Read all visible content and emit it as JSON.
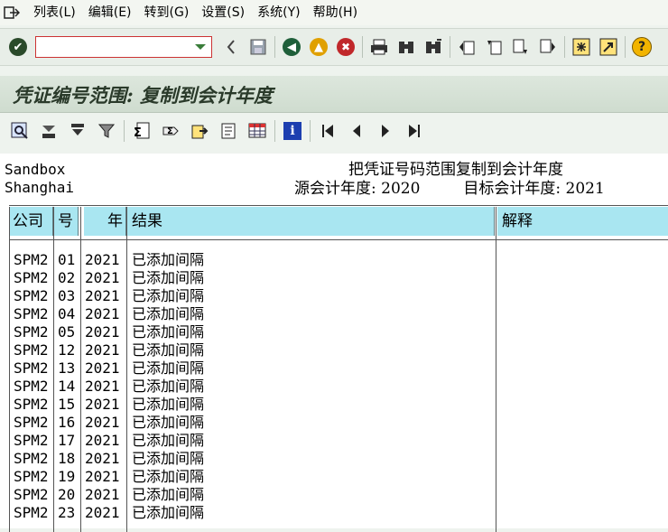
{
  "menubar": {
    "items": [
      {
        "label": "列表(L)"
      },
      {
        "label": "编辑(E)"
      },
      {
        "label": "转到(G)"
      },
      {
        "label": "设置(S)"
      },
      {
        "label": "系统(Y)"
      },
      {
        "label": "帮助(H)"
      }
    ]
  },
  "toolbar": {
    "command_value": "",
    "command_placeholder": ""
  },
  "titlebar": {
    "title": "凭证编号范围: 复制到会计年度"
  },
  "report": {
    "client_line1": "Sandbox",
    "client_line2": "Shanghai",
    "heading": "把凭证号码范围复制到会计年度",
    "source_year_label": "源会计年度: 2020",
    "target_year_label": "目标会计年度: 2021",
    "columns": {
      "company": "公司",
      "number": "号",
      "year": "年",
      "result": "结果",
      "explanation": "解释"
    },
    "rows": [
      {
        "company": "SPM2",
        "number": "01",
        "year": "2021",
        "result": "已添加间隔",
        "explanation": ""
      },
      {
        "company": "SPM2",
        "number": "02",
        "year": "2021",
        "result": "已添加间隔",
        "explanation": ""
      },
      {
        "company": "SPM2",
        "number": "03",
        "year": "2021",
        "result": "已添加间隔",
        "explanation": ""
      },
      {
        "company": "SPM2",
        "number": "04",
        "year": "2021",
        "result": "已添加间隔",
        "explanation": ""
      },
      {
        "company": "SPM2",
        "number": "05",
        "year": "2021",
        "result": "已添加间隔",
        "explanation": ""
      },
      {
        "company": "SPM2",
        "number": "12",
        "year": "2021",
        "result": "已添加间隔",
        "explanation": ""
      },
      {
        "company": "SPM2",
        "number": "13",
        "year": "2021",
        "result": "已添加间隔",
        "explanation": ""
      },
      {
        "company": "SPM2",
        "number": "14",
        "year": "2021",
        "result": "已添加间隔",
        "explanation": ""
      },
      {
        "company": "SPM2",
        "number": "15",
        "year": "2021",
        "result": "已添加间隔",
        "explanation": ""
      },
      {
        "company": "SPM2",
        "number": "16",
        "year": "2021",
        "result": "已添加间隔",
        "explanation": ""
      },
      {
        "company": "SPM2",
        "number": "17",
        "year": "2021",
        "result": "已添加间隔",
        "explanation": ""
      },
      {
        "company": "SPM2",
        "number": "18",
        "year": "2021",
        "result": "已添加间隔",
        "explanation": ""
      },
      {
        "company": "SPM2",
        "number": "19",
        "year": "2021",
        "result": "已添加间隔",
        "explanation": ""
      },
      {
        "company": "SPM2",
        "number": "20",
        "year": "2021",
        "result": "已添加间隔",
        "explanation": ""
      },
      {
        "company": "SPM2",
        "number": "23",
        "year": "2021",
        "result": "已添加间隔",
        "explanation": ""
      }
    ]
  },
  "colors": {
    "column_header_bg": "#a9e6f1",
    "window_bg": "#eef3ee",
    "title_text": "#2a3a2a"
  }
}
